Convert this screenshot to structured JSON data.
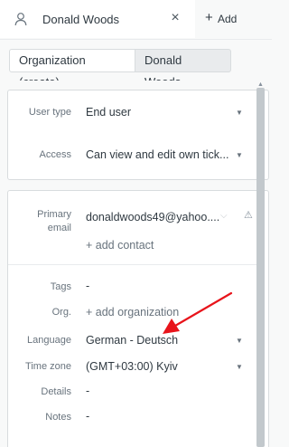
{
  "tabs": {
    "active_label": "Donald Woods",
    "close_glyph": "×",
    "add_glyph": "+",
    "add_label": "Add"
  },
  "breadcrumb": {
    "items": [
      "Organization (create)",
      "Donald Woods"
    ]
  },
  "details1": {
    "user_type_label": "User type",
    "user_type_value": "End user",
    "access_label": "Access",
    "access_value": "Can view and edit own tick..."
  },
  "details2": {
    "primary_email_label": "Primary\nemail",
    "primary_email_label_1": "Primary",
    "primary_email_label_2": "email",
    "primary_email_value": "donaldwoods49@yahoo....",
    "add_contact": "+ add contact",
    "tags_label": "Tags",
    "tags_value": "-",
    "org_label": "Org.",
    "org_value": "+ add organization",
    "language_label": "Language",
    "language_value": "German - Deutsch",
    "timezone_label": "Time zone",
    "timezone_value": "(GMT+03:00) Kyiv",
    "details_label": "Details",
    "details_value": "-",
    "notes_label": "Notes",
    "notes_value": "-"
  },
  "colors": {
    "annotation_arrow": "#e8141b",
    "thumb": "#c2c8cc"
  },
  "icons": [
    "user-icon",
    "close-icon",
    "plus-icon",
    "chevron-down-icon",
    "warning-icon",
    "arrow-annotation"
  ]
}
